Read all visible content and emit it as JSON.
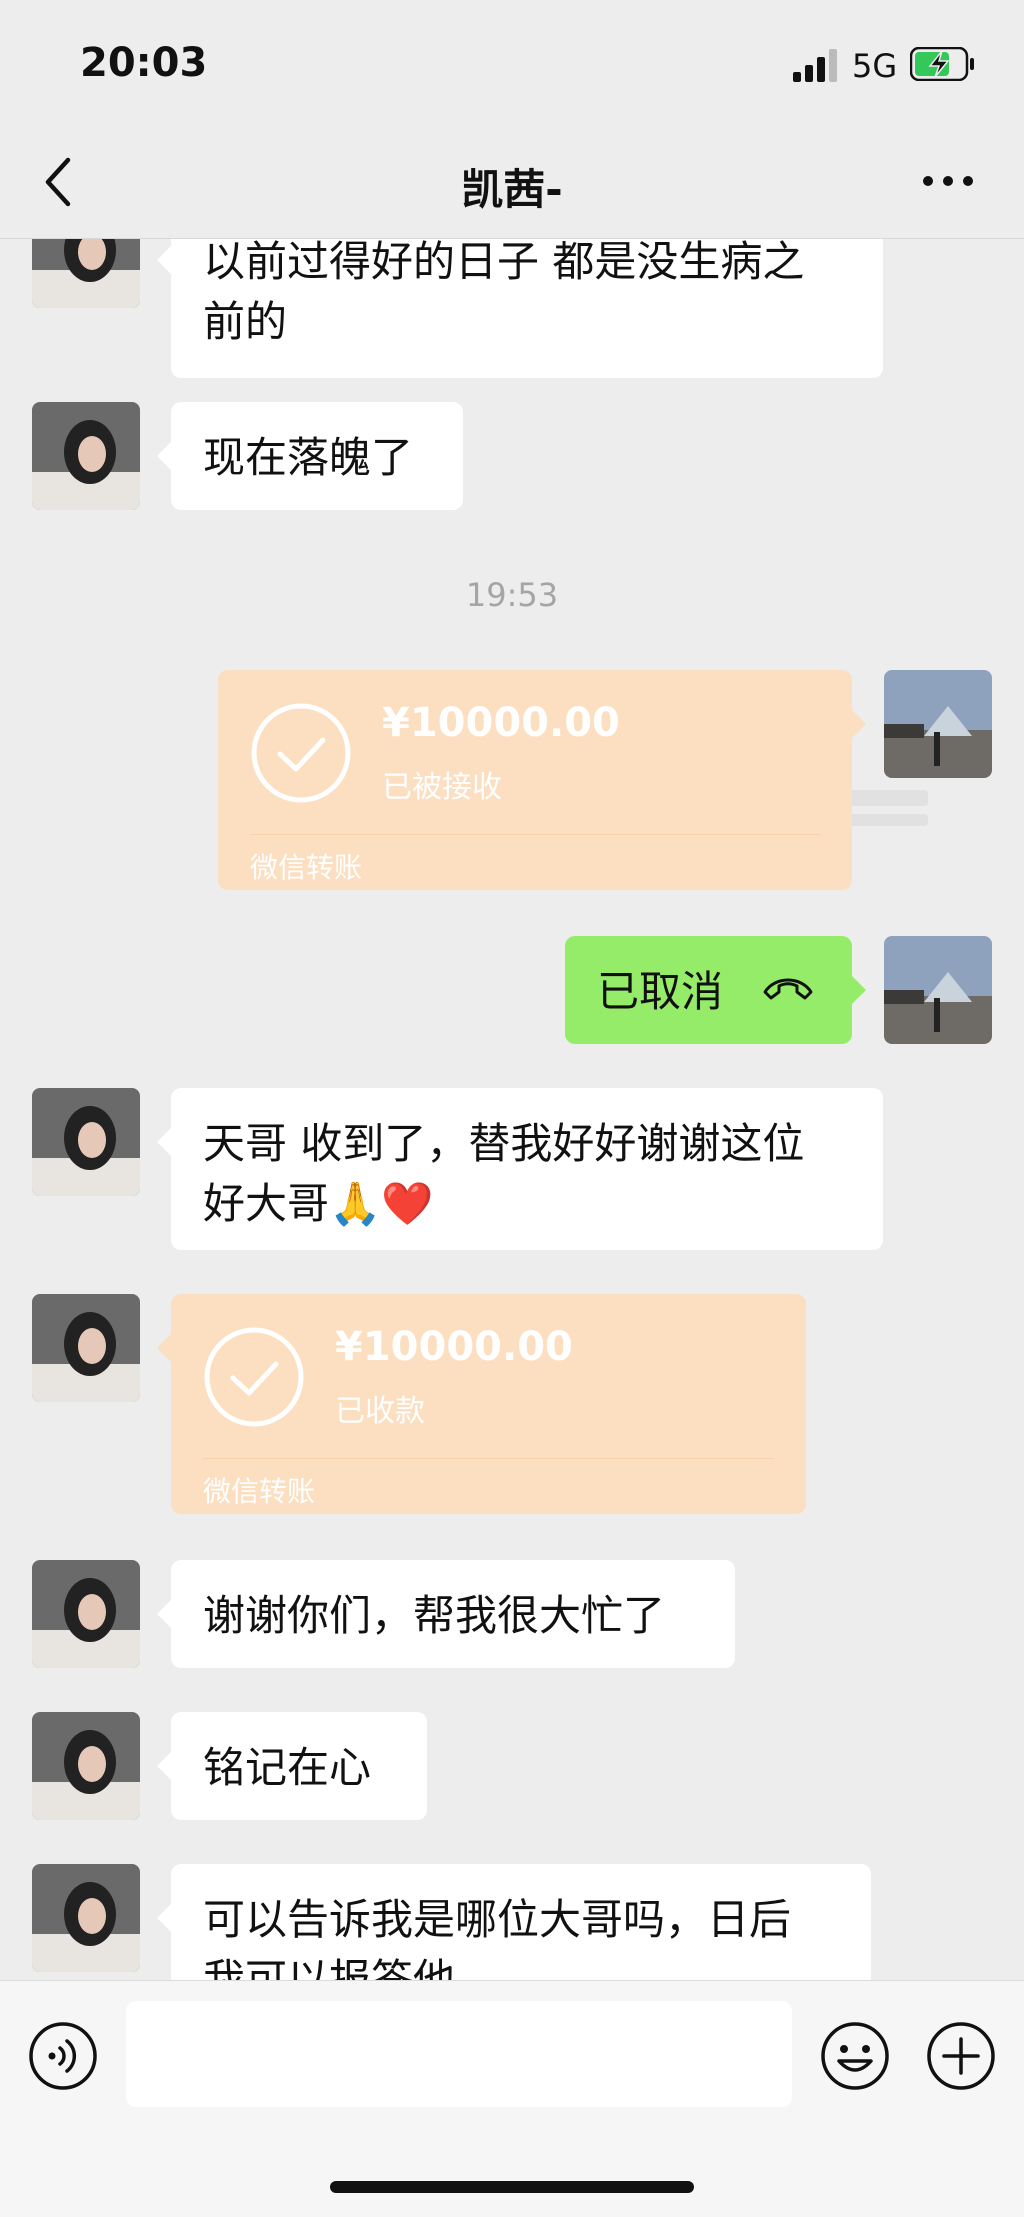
{
  "status_bar": {
    "time": "20:03",
    "network": "5G"
  },
  "header": {
    "title": "凯茜-"
  },
  "messages": {
    "m1": {
      "line1": "以前过得好的日子 都是没生病之",
      "line2": "前的"
    },
    "m2": {
      "text": "现在落魄了"
    },
    "timestamp": "19:53",
    "transfer1": {
      "amount": "¥10000.00",
      "status": "已被接收",
      "label": "微信转账"
    },
    "call": {
      "text": "已取消",
      "icon": "phone-hangup-icon"
    },
    "m3": {
      "line1": "天哥 收到了，替我好好谢谢这位",
      "line2": "好大哥🙏❤️"
    },
    "transfer2": {
      "amount": "¥10000.00",
      "status": "已收款",
      "label": "微信转账"
    },
    "m4": {
      "text": "谢谢你们，帮我很大忙了"
    },
    "m5": {
      "text": "铭记在心"
    },
    "m6": {
      "line1": "可以告诉我是哪位大哥吗，日后",
      "line2": "我可以报答他"
    }
  },
  "colors": {
    "background": "#ededed",
    "green_bubble": "#95ec69",
    "transfer": "#fbdfc0"
  }
}
